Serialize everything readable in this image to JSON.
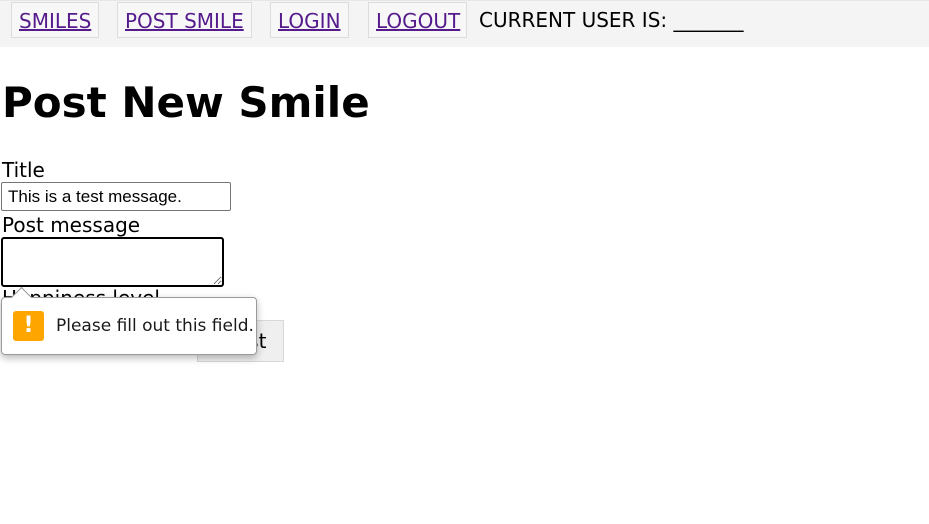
{
  "nav": {
    "links": [
      "SMILES",
      "POST SMILE",
      "LOGIN",
      "LOGOUT"
    ],
    "current_user_text": "CURRENT USER IS: _______"
  },
  "page": {
    "heading": "Post New Smile"
  },
  "form": {
    "title_label": "Title",
    "title_value": "This is a test message.",
    "message_label": "Post message",
    "message_value": "",
    "hidden_label": "Happiness level",
    "submit_label": "Post"
  },
  "validation": {
    "message": "Please fill out this field.",
    "icon": "!"
  },
  "colors": {
    "link": "#551a8b",
    "warning": "#ffa500",
    "nav_bg": "#f4f4f4"
  }
}
